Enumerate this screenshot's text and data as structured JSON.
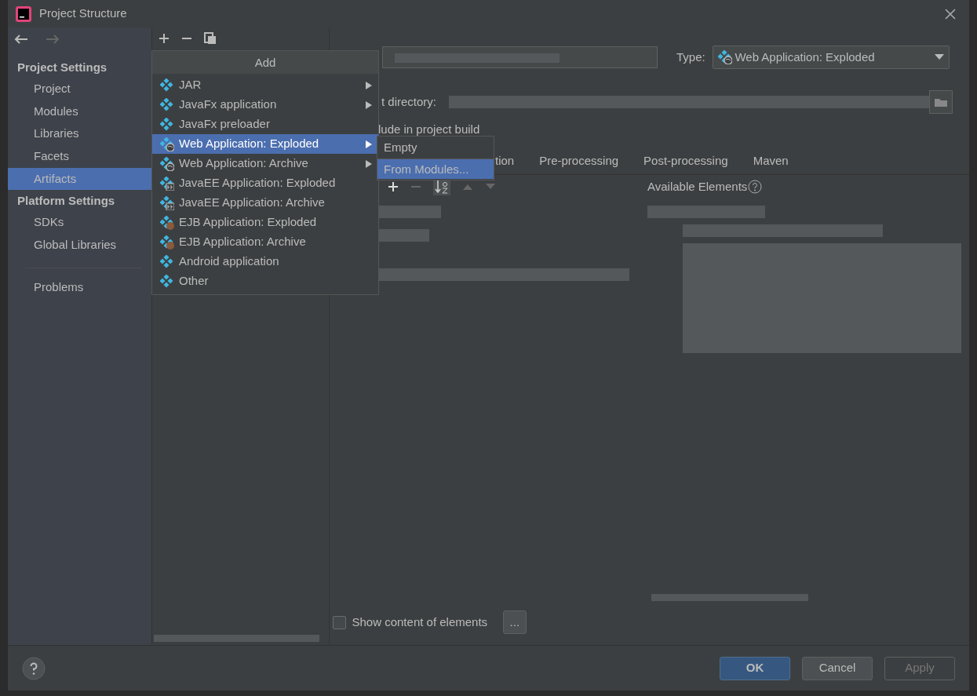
{
  "window": {
    "title": "Project Structure"
  },
  "sidebar": {
    "sections": [
      {
        "heading": "Project Settings",
        "items": [
          {
            "label": "Project",
            "selected": false
          },
          {
            "label": "Modules",
            "selected": false
          },
          {
            "label": "Libraries",
            "selected": false
          },
          {
            "label": "Facets",
            "selected": false
          },
          {
            "label": "Artifacts",
            "selected": true
          }
        ]
      },
      {
        "heading": "Platform Settings",
        "items": [
          {
            "label": "SDKs",
            "selected": false
          },
          {
            "label": "Global Libraries",
            "selected": false
          }
        ]
      }
    ],
    "extra_items": [
      {
        "label": "Problems",
        "selected": false
      }
    ]
  },
  "add_menu": {
    "title": "Add",
    "items": [
      {
        "label": "JAR",
        "kind": "artifact",
        "has_submenu": true,
        "selected": false
      },
      {
        "label": "JavaFx application",
        "kind": "artifact",
        "has_submenu": true,
        "selected": false
      },
      {
        "label": "JavaFx preloader",
        "kind": "artifact",
        "has_submenu": false,
        "selected": false
      },
      {
        "label": "Web Application: Exploded",
        "kind": "web",
        "has_submenu": true,
        "selected": true
      },
      {
        "label": "Web Application: Archive",
        "kind": "web",
        "has_submenu": true,
        "selected": false
      },
      {
        "label": "JavaEE Application: Exploded",
        "kind": "javaee",
        "has_submenu": false,
        "selected": false
      },
      {
        "label": "JavaEE Application: Archive",
        "kind": "javaee",
        "has_submenu": false,
        "selected": false
      },
      {
        "label": "EJB Application: Exploded",
        "kind": "ejb",
        "has_submenu": false,
        "selected": false
      },
      {
        "label": "EJB Application: Archive",
        "kind": "ejb",
        "has_submenu": false,
        "selected": false
      },
      {
        "label": "Android application",
        "kind": "artifact",
        "has_submenu": false,
        "selected": false
      },
      {
        "label": "Other",
        "kind": "artifact",
        "has_submenu": false,
        "selected": false
      }
    ]
  },
  "submenu": {
    "items": [
      {
        "label": "Empty",
        "selected": false
      },
      {
        "label": "From Modules...",
        "selected": true
      }
    ]
  },
  "artifact": {
    "type_label": "Type:",
    "type_value": "Web Application: Exploded",
    "output_directory_label": "t directory:",
    "include_label": "lude in project build",
    "tabs": [
      {
        "label": "tion",
        "selected": false
      },
      {
        "label": "Pre-processing",
        "selected": false
      },
      {
        "label": "Post-processing",
        "selected": false
      },
      {
        "label": "Maven",
        "selected": false
      }
    ],
    "available_elements_label": "Available Elements",
    "show_content": {
      "label": "Show content of elements",
      "checked": false
    },
    "browse_button": "..."
  },
  "buttons": [
    {
      "label": "OK",
      "kind": "primary"
    },
    {
      "label": "Cancel",
      "kind": "normal"
    },
    {
      "label": "Apply",
      "kind": "disabled"
    }
  ]
}
